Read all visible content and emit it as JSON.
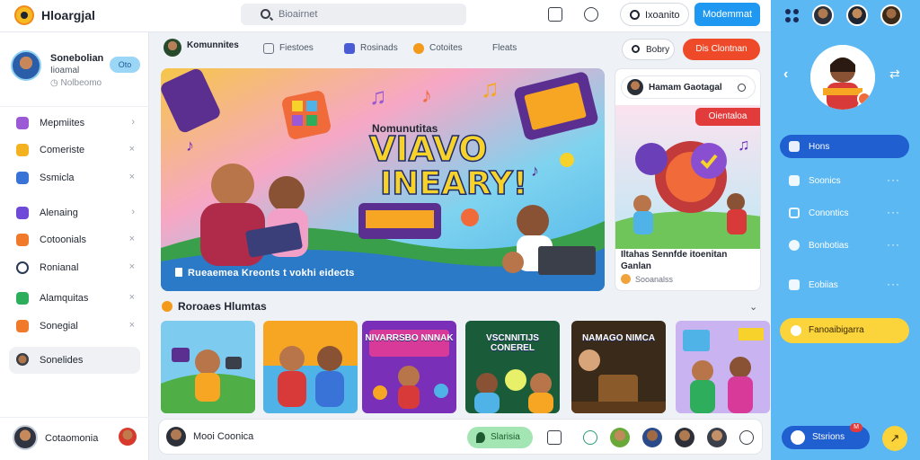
{
  "app": {
    "title": "Hloargjal"
  },
  "search": {
    "placeholder": "Bioairnet"
  },
  "topbar": {
    "outline_button": "Ixoanito",
    "primary_button": "Modemmat"
  },
  "profile": {
    "name": "Sonebolian",
    "subtitle": "Iioamal",
    "meta": "Nolbeomo",
    "toggle": "Oto"
  },
  "sidebar": {
    "items": [
      {
        "label": "Mepmiites",
        "mark": "›",
        "color": "#9b59d6"
      },
      {
        "label": "Comeriste",
        "mark": "×",
        "color": "#f5b220"
      },
      {
        "label": "Ssmicla",
        "mark": "×",
        "color": "#3a73d8"
      },
      {
        "label": "Alenaing",
        "mark": "›",
        "color": "#6f4ad8"
      },
      {
        "label": "Cotoonials",
        "mark": "×",
        "color": "#f07a2a"
      },
      {
        "label": "Ronianal",
        "mark": "×",
        "color": "#2a3a55"
      },
      {
        "label": "Alamquitas",
        "mark": "×",
        "color": "#2eae5c"
      },
      {
        "label": "Sonegial",
        "mark": "×",
        "color": "#f07a2a"
      },
      {
        "label": "Sonelides",
        "mark": "",
        "color": ""
      }
    ],
    "footer_label": "Cotaomonia"
  },
  "tabs": [
    {
      "label": "Komunnites",
      "color": ""
    },
    {
      "label": "Fiestoes",
      "color": "#6b7280"
    },
    {
      "label": "Rosinads",
      "color": "#4a5bd6"
    },
    {
      "label": "Cotoites",
      "color": "#f39a1c"
    },
    {
      "label": "Fleats",
      "color": ""
    }
  ],
  "actions": {
    "outline": "Bobry",
    "red": "Dis Clontnan"
  },
  "hero": {
    "small_title": "Nomunutitas",
    "big_line1": "VIAVO",
    "big_line2": "INEARY!",
    "caption": "Rueaemea Kreonts t vokhi eidects"
  },
  "side_card": {
    "header": "Hamam Gaotagal",
    "badge": "Oientaloa",
    "title": "Iltahas Sennfde itoenitan Ganlan",
    "meta": "Sooanalss"
  },
  "section": {
    "title": "Roroaes Hlumtas"
  },
  "thumbs": [
    {
      "text": "",
      "bg": "#7ecbf0"
    },
    {
      "text": "",
      "bg": "#f6a623"
    },
    {
      "text": "NIVARRSBO NNNAK",
      "bg": "#7a2fb8"
    },
    {
      "text": "VSCNNITIJS CONEREL",
      "bg": "#1a5c3a"
    },
    {
      "text": "NAMAGO NIMCA",
      "bg": "#3a2a1a"
    },
    {
      "text": "",
      "bg": "#9bd0f5"
    }
  ],
  "bottombar": {
    "label": "Mooi Coonica",
    "green": "Slarisia"
  },
  "right_panel": {
    "items": [
      {
        "label": "Hons",
        "active": true
      },
      {
        "label": "Soonics",
        "active": false
      },
      {
        "label": "Conontics",
        "active": false
      },
      {
        "label": "Bonbotias",
        "active": false
      },
      {
        "label": "Eobiias",
        "active": false
      }
    ],
    "yellow_button": "Fanoaibigarra",
    "bottom_button": "Stsrions",
    "badge": "M"
  },
  "colors": {
    "accent_blue": "#1f98f2",
    "right_panel": "#5cb8f2",
    "red": "#ee4a2a",
    "yellow": "#fbd33a"
  }
}
